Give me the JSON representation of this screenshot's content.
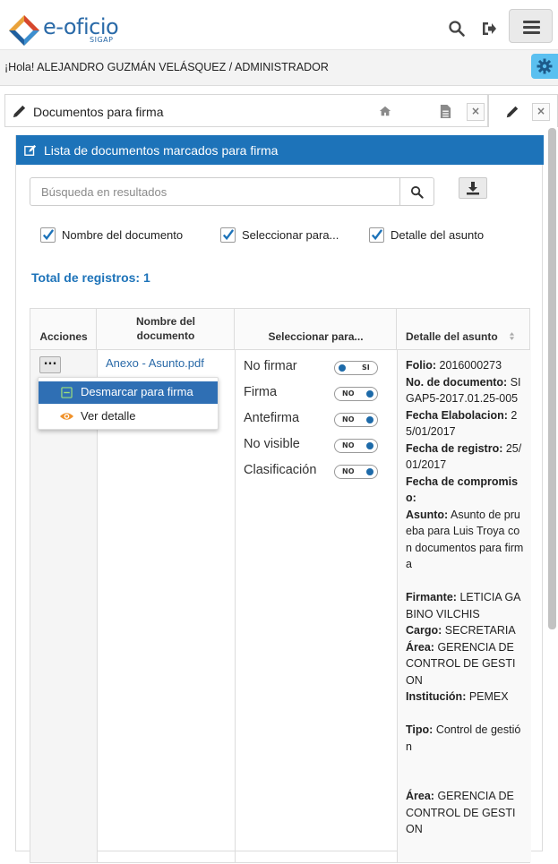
{
  "app": {
    "logo_text": "e-oficio",
    "logo_sub": "SIGAP"
  },
  "header": {
    "greeting": "¡Hola! ALEJANDRO GUZMÁN VELÁSQUEZ / ADMINISTRADOR",
    "icons": [
      "search-icon",
      "logout-icon",
      "hamburger-menu-icon",
      "gear-icon"
    ]
  },
  "tabs": [
    {
      "label": "Documentos para firma",
      "close": "×"
    },
    {
      "label": "",
      "close": "×"
    }
  ],
  "panel": {
    "title": "Lista de documentos marcados para firma"
  },
  "search": {
    "placeholder": "Búsqueda en resultados"
  },
  "checkboxes": [
    {
      "label": "Nombre del documento",
      "checked": true
    },
    {
      "label": "Seleccionar para...",
      "checked": true
    },
    {
      "label": "Detalle del asunto",
      "checked": true
    }
  ],
  "total": "Total de registros: 1",
  "table": {
    "headers": [
      "Acciones",
      "Nombre del documento",
      "Seleccionar para...",
      "Detalle del asunto"
    ],
    "row": {
      "actions_label": "...",
      "document": "Anexo - Asunto.pdf",
      "options": [
        {
          "label": "No firmar",
          "toggle": "SI",
          "on": true
        },
        {
          "label": "Firma",
          "toggle": "NO",
          "on": false
        },
        {
          "label": "Antefirma",
          "toggle": "NO",
          "on": false
        },
        {
          "label": "No visible",
          "toggle": "NO",
          "on": false
        },
        {
          "label": "Clasificación",
          "toggle": "NO",
          "on": false
        }
      ],
      "detail": {
        "folio_label": "Folio:",
        "folio": "2016000273",
        "nodoc_label": "No. de documento:",
        "nodoc": "SIGAP5-2017.01.25-005",
        "felab_label": "Fecha Elabolacion:",
        "felab": "25/01/2017",
        "freg_label": "Fecha de registro:",
        "freg": "25/01/2017",
        "fcomp_label": "Fecha de compromiso:",
        "asunto_label": "Asunto:",
        "asunto": "Asunto de prueba para Luis Troya con documentos para firma",
        "firmante_label": "Firmante:",
        "firmante": "LETICIA GABINO VILCHIS",
        "cargo_label": "Cargo:",
        "cargo": "SECRETARIA",
        "area_label": "Área:",
        "area": "GERENCIA DE CONTROL DE GESTION",
        "inst_label": "Institución:",
        "inst": "PEMEX",
        "tipo_label": "Tipo:",
        "tipo": "Control de gestión",
        "area2_label": "Área:",
        "area2": "GERENCIA DE CONTROL DE GESTION"
      }
    },
    "dropdown": [
      {
        "label": "Desmarcar para firma",
        "icon": "minus-square-icon"
      },
      {
        "label": "Ver detalle",
        "icon": "eye-icon"
      }
    ]
  }
}
